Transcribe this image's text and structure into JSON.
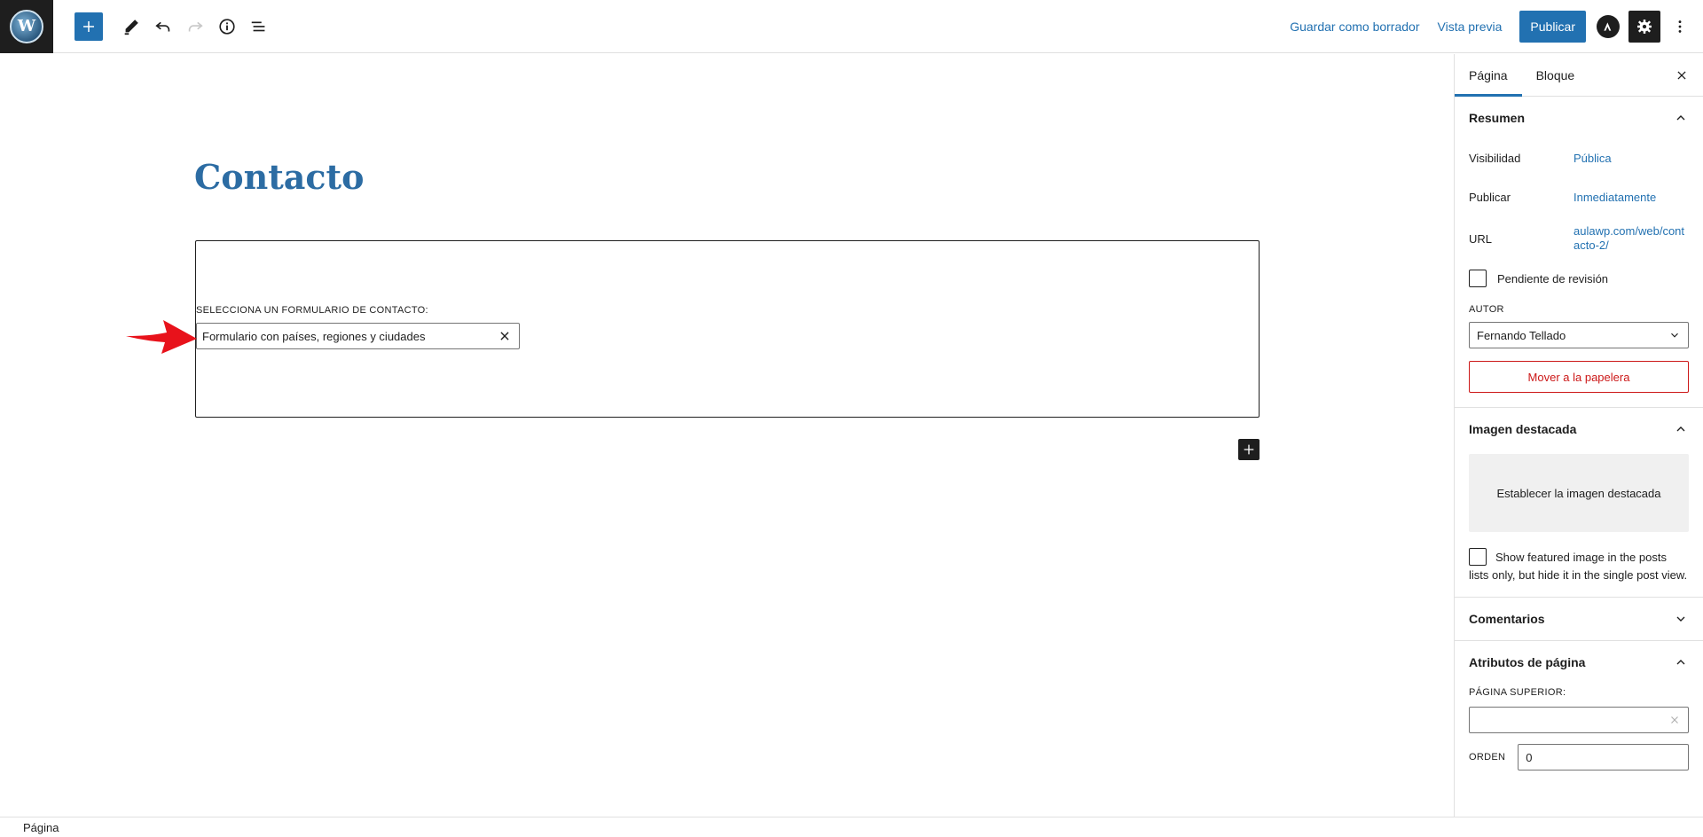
{
  "topbar": {
    "save_draft": "Guardar como borrador",
    "preview": "Vista previa",
    "publish": "Publicar",
    "icons": [
      "wordpress-logo",
      "add-block-icon",
      "edit-pencil-icon",
      "undo-icon",
      "redo-icon",
      "info-icon",
      "list-view-icon",
      "astra-icon",
      "settings-gear-icon",
      "more-options-icon"
    ]
  },
  "editor": {
    "title": "Contacto",
    "cf7": {
      "label": "SELECCIONA UN FORMULARIO DE CONTACTO:",
      "selected": "Formulario con países, regiones y ciudades"
    }
  },
  "sidebar": {
    "tabs": [
      "Página",
      "Bloque"
    ],
    "summary": {
      "title": "Resumen",
      "visibility_label": "Visibilidad",
      "visibility_value": "Pública",
      "publish_label": "Publicar",
      "publish_value": "Inmediatamente",
      "url_label": "URL",
      "url_value": "aulawp.com/web/contacto-2/",
      "pending_review": "Pendiente de revisión",
      "author_label": "AUTOR",
      "author_value": "Fernando Tellado",
      "trash": "Mover a la papelera"
    },
    "featured": {
      "title": "Imagen destacada",
      "set_image": "Establecer la imagen destacada",
      "show_note": "Show featured image in the posts lists only, but hide it in the single post view."
    },
    "comments": {
      "title": "Comentarios"
    },
    "attributes": {
      "title": "Atributos de página",
      "parent_label": "PÁGINA SUPERIOR:",
      "order_label": "ORDEN",
      "order_value": "0"
    }
  },
  "footer": {
    "breadcrumb": "Página"
  },
  "colors": {
    "accent": "#2271b1",
    "danger": "#cc1818",
    "arrow": "#e8121b",
    "title": "#2c6ca3"
  }
}
